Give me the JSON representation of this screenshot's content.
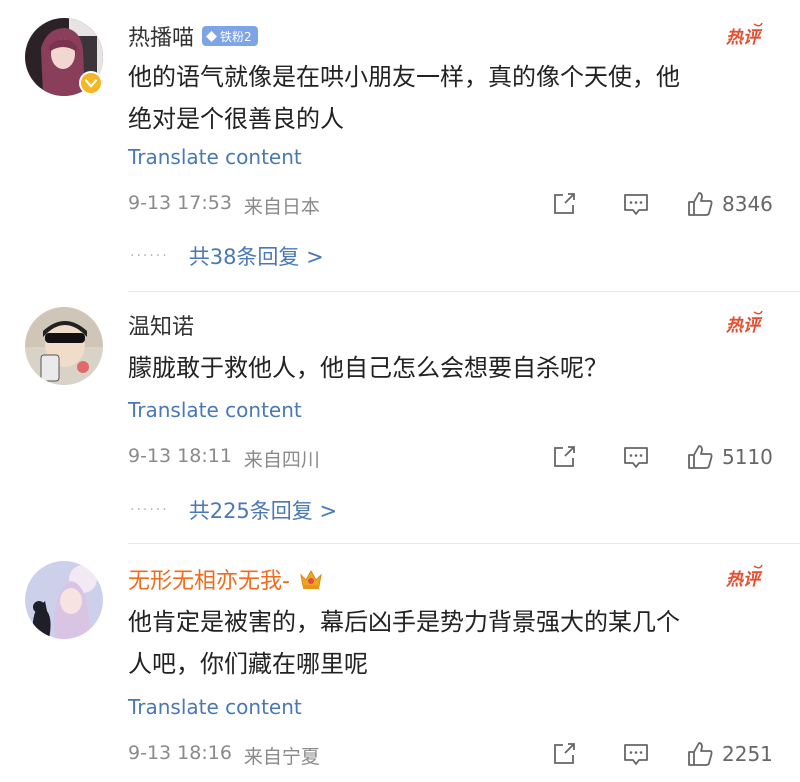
{
  "colors": {
    "link": "#4a78b5",
    "hot": "#e54d2e",
    "vip_name": "#f26b1d",
    "fan_badge": "#7da4e6"
  },
  "comments": [
    {
      "username": "热播喵",
      "fan_badge": "铁粉2",
      "hot_tag": "热评",
      "text_lines": [
        "他的语气就像是在哄小朋友一样，真的像个天使，他",
        "绝对是个很善良的人"
      ],
      "translate": "Translate content",
      "time": "9-13 17:53",
      "location": "来自日本",
      "likes": "8346",
      "replies": "共38条回复 >"
    },
    {
      "username": "温知诺",
      "hot_tag": "热评",
      "text_lines": [
        "朦胧敢于救他人，他自己怎么会想要自杀呢？"
      ],
      "translate": "Translate content",
      "time": "9-13 18:11",
      "location": "来自四川",
      "likes": "5110",
      "replies": "共225条回复 >"
    },
    {
      "username": "无形无相亦无我-",
      "hot_tag": "热评",
      "text_lines": [
        "他肯定是被害的，幕后凶手是势力背景强大的某几个",
        "人吧，你们藏在哪里呢"
      ],
      "translate": "Translate content",
      "time": "9-13 18:16",
      "location": "来自宁夏",
      "likes": "2251"
    }
  ]
}
